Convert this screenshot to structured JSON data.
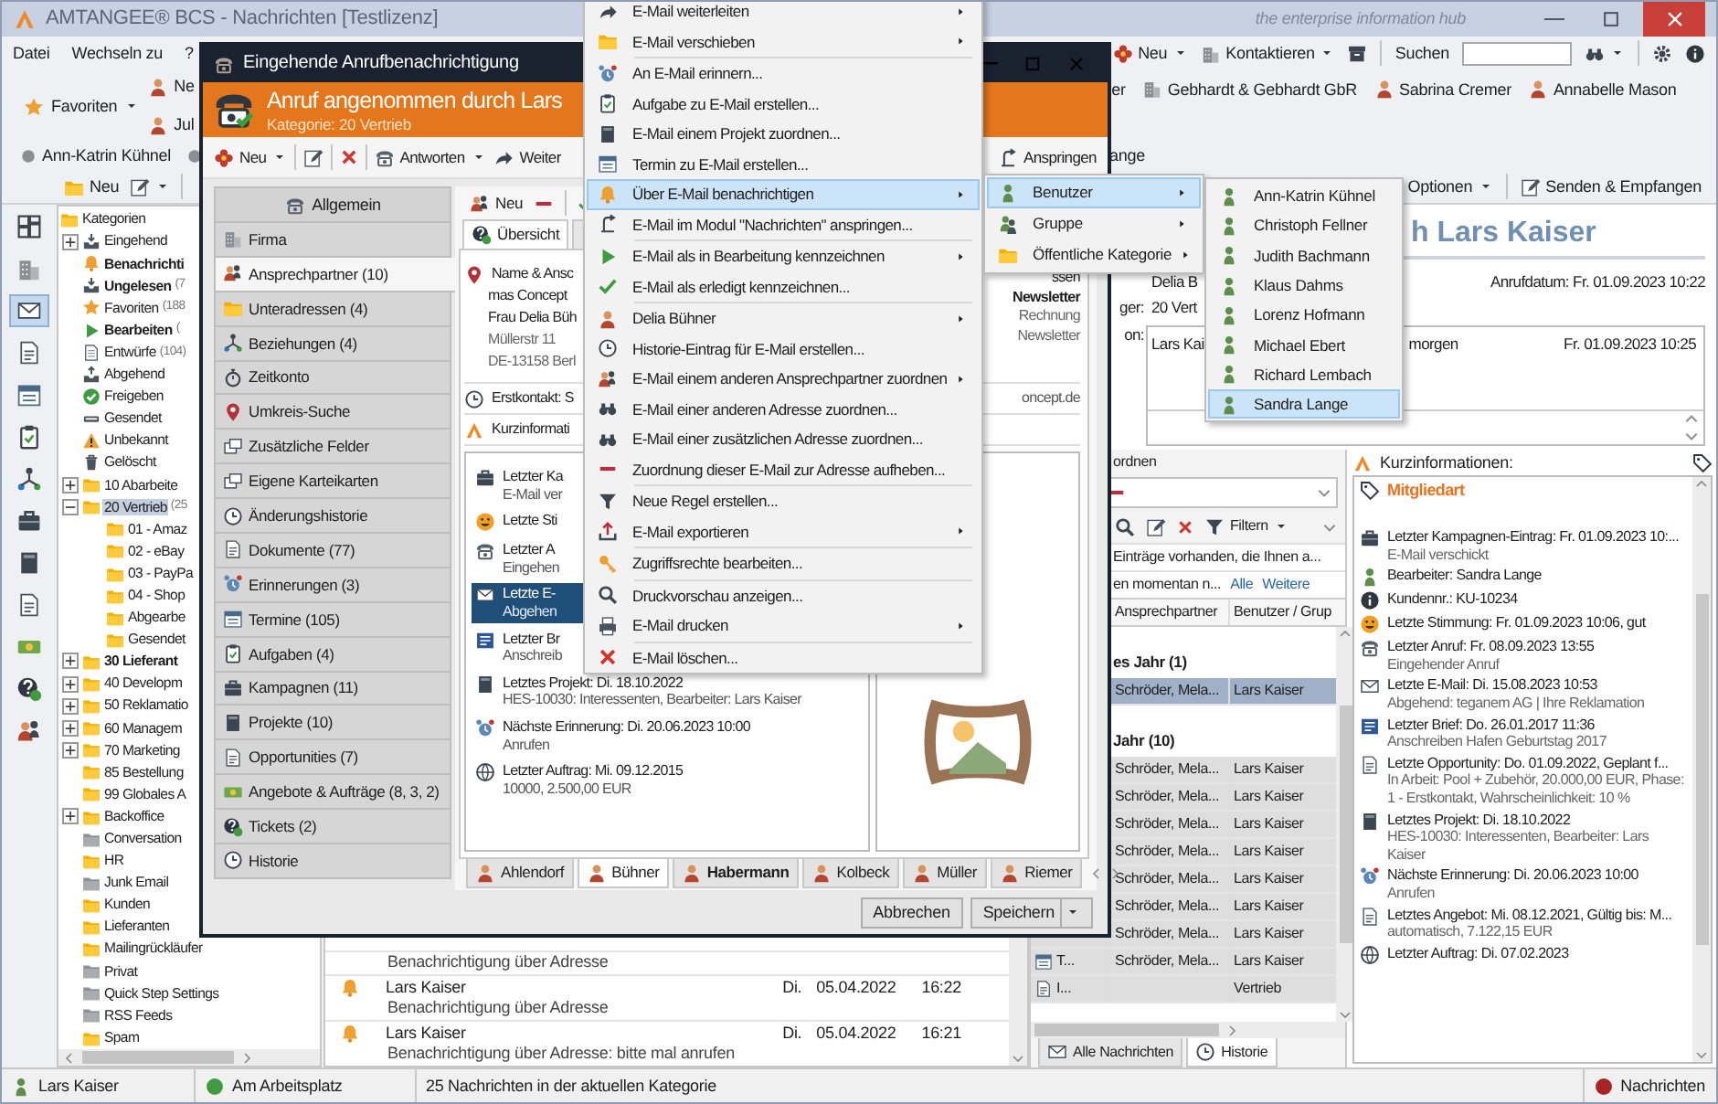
{
  "window": {
    "title": "AMTANGEE® BCS - Nachrichten [Testlizenz]",
    "tagline": "the enterprise information hub"
  },
  "menu_bar": [
    "Datei",
    "Wechseln zu",
    "?"
  ],
  "main_toolbar": {
    "new_label": "Neu",
    "contact_label": "Kontaktieren",
    "search_label": "Suchen"
  },
  "favorites": {
    "label": "Favoriten",
    "left": [
      {
        "label": "Ne",
        "kind": "person"
      },
      {
        "label": "Jul",
        "kind": "person"
      }
    ],
    "right": [
      {
        "label": "er",
        "kind": "none"
      },
      {
        "label": "Gebhardt & Gebhardt GbR",
        "kind": "company"
      },
      {
        "label": "Sabrina Cremer",
        "kind": "person"
      },
      {
        "label": "Annabelle Mason",
        "kind": "person"
      }
    ]
  },
  "users_bar": {
    "items": [
      "Ann-Katrin Kühnel"
    ],
    "trailing": "ange"
  },
  "module_toolbar": {
    "new_label": "Neu",
    "options_label": "Optionen",
    "send_label": "Senden & Empfangen"
  },
  "nav_icons": [
    {
      "kind": "dashboard",
      "selected": false
    },
    {
      "kind": "companies",
      "selected": false
    },
    {
      "kind": "messages",
      "selected": true
    },
    {
      "kind": "documents",
      "selected": false
    },
    {
      "kind": "calendar",
      "selected": false
    },
    {
      "kind": "tasks",
      "selected": false
    },
    {
      "kind": "relations",
      "selected": false
    },
    {
      "kind": "campaigns",
      "selected": false
    },
    {
      "kind": "projects",
      "selected": false
    },
    {
      "kind": "opportunities",
      "selected": false
    },
    {
      "kind": "offers",
      "selected": false
    },
    {
      "kind": "tickets",
      "selected": false
    },
    {
      "kind": "users",
      "selected": false
    }
  ],
  "categories": {
    "root": "Kategorien",
    "items": [
      {
        "label": "Eingehend",
        "kind": "inbox",
        "expanded": false,
        "bold": false,
        "selected": false
      },
      {
        "label": "Benachrichti",
        "kind": "notification",
        "bold": true,
        "selected": false
      },
      {
        "label": "Ungelesen",
        "count": "(7",
        "kind": "inbox",
        "bold": true,
        "selected": false
      },
      {
        "label": "Favoriten",
        "count": "(188",
        "kind": "favorites",
        "bold": false,
        "selected": false
      },
      {
        "label": "Bearbeiten",
        "count": "(",
        "kind": "processing",
        "bold": true,
        "selected": false
      },
      {
        "label": "Entwürfe",
        "count": "(104)",
        "kind": "drafts",
        "bold": false,
        "selected": false
      },
      {
        "label": "Abgehend",
        "kind": "outbox",
        "bold": false,
        "selected": false
      },
      {
        "label": "Freigeben",
        "kind": "approval",
        "bold": false,
        "selected": false
      },
      {
        "label": "Gesendet",
        "kind": "sent",
        "bold": false,
        "selected": false
      },
      {
        "label": "Unbekannt",
        "kind": "unknown",
        "bold": false,
        "selected": false
      },
      {
        "label": "Gelöscht",
        "kind": "trash",
        "bold": false,
        "selected": false
      },
      {
        "label": "10 Abarbeite",
        "kind": "folder",
        "expanded": false,
        "bold": false,
        "selected": false
      },
      {
        "label": "20 Vertrieb",
        "count": "(25",
        "kind": "folder",
        "expanded": true,
        "bold": false,
        "selected": true,
        "children": [
          {
            "label": "01 - Amaz",
            "kind": "folder",
            "bold": false,
            "selected": false
          },
          {
            "label": "02 - eBay",
            "kind": "folder",
            "bold": false,
            "selected": false
          },
          {
            "label": "03 - PayPa",
            "kind": "folder",
            "bold": false,
            "selected": false
          },
          {
            "label": "04 - Shop",
            "kind": "folder",
            "bold": false,
            "selected": false
          },
          {
            "label": "Abgearbe",
            "kind": "folder",
            "bold": false,
            "selected": false
          },
          {
            "label": "Gesendet",
            "kind": "folder",
            "bold": false,
            "selected": false
          }
        ]
      },
      {
        "label": "30 Lieferant",
        "kind": "folder",
        "expanded": false,
        "bold": true,
        "selected": false
      },
      {
        "label": "40 Developm",
        "kind": "folder",
        "expanded": false,
        "bold": false,
        "selected": false
      },
      {
        "label": "50 Reklamatio",
        "kind": "folder",
        "expanded": false,
        "bold": false,
        "selected": false
      },
      {
        "label": "60 Managem",
        "kind": "folder",
        "expanded": false,
        "bold": false,
        "selected": false
      },
      {
        "label": "70 Marketing",
        "kind": "folder",
        "expanded": false,
        "bold": false,
        "selected": false
      },
      {
        "label": "85 Bestellung",
        "kind": "folder",
        "bold": false,
        "selected": false
      },
      {
        "label": "99 Globales A",
        "kind": "folder",
        "bold": false,
        "selected": false
      },
      {
        "label": "Backoffice",
        "kind": "folder",
        "expanded": false,
        "bold": false,
        "selected": false
      },
      {
        "label": "Conversation",
        "kind": "system",
        "bold": false,
        "selected": false
      },
      {
        "label": "HR",
        "kind": "folder",
        "bold": false,
        "selected": false
      },
      {
        "label": "Junk Email",
        "kind": "system",
        "bold": false,
        "selected": false
      },
      {
        "label": "Kunden",
        "kind": "folder",
        "bold": false,
        "selected": false
      },
      {
        "label": "Lieferanten",
        "kind": "folder",
        "bold": false,
        "selected": false
      },
      {
        "label": "Mailingrückläufer",
        "kind": "folder",
        "bold": false,
        "selected": false
      },
      {
        "label": "Privat",
        "kind": "system",
        "bold": false,
        "selected": false
      },
      {
        "label": "Quick Step Settings",
        "kind": "system",
        "bold": false,
        "selected": false
      },
      {
        "label": "RSS Feeds",
        "kind": "system",
        "bold": false,
        "selected": false
      },
      {
        "label": "Spam",
        "kind": "folder",
        "bold": false,
        "selected": false
      }
    ]
  },
  "messages": [
    {
      "subject": "Benachrichtigung über Adresse"
    },
    {
      "sender": "Lars Kaiser",
      "day": "Di.",
      "date": "05.04.2022",
      "time": "16:22",
      "subject": "Benachrichtigung über Adresse"
    },
    {
      "sender": "Lars Kaiser",
      "day": "Di.",
      "date": "05.04.2022",
      "time": "16:21",
      "subject": "Benachrichtigung über Adresse: bitte mal anrufen"
    }
  ],
  "reading_pane": {
    "title": "h Lars Kaiser",
    "call_date": "Anrufdatum: Fr. 01.09.2023 10:22",
    "fields": [
      {
        "value": "Delia B"
      },
      {
        "label": "ger:",
        "value": "20 Vert"
      }
    ],
    "notes_label": "on:",
    "note": {
      "author": "Lars Kai",
      "text": "morgen",
      "date": "Fr. 01.09.2023 10:25"
    }
  },
  "linked_panel": {
    "title": "ordnen",
    "filter_label": "Filtern",
    "notice": "Einträge vorhanden, die Ihnen a...",
    "notice2": "en momentan n...",
    "links": [
      "Alle",
      "Weitere"
    ],
    "columns": [
      "Ansprechpartner",
      "Benutzer / Grup"
    ],
    "groups": [
      {
        "label": "es Jahr (1)",
        "rows": [
          {
            "contact": "Schröder, Mela...",
            "user": "Lars Kaiser",
            "selected": true
          }
        ]
      },
      {
        "label": "Jahr (10)",
        "rows": [
          {
            "contact": "Schröder, Mela...",
            "user": "Lars Kaiser",
            "selected": false
          },
          {
            "contact": "Schröder, Mela...",
            "user": "Lars Kaiser",
            "selected": false
          },
          {
            "contact": "Schröder, Mela...",
            "user": "Lars Kaiser",
            "selected": false
          },
          {
            "contact": "Schröder, Mela...",
            "user": "Lars Kaiser",
            "selected": false
          },
          {
            "contact": "Schröder, Mela...",
            "user": "Lars Kaiser",
            "selected": false
          },
          {
            "contact": "Schröder, Mela...",
            "user": "Lars Kaiser",
            "selected": false
          },
          {
            "contact": "Schröder, Mela...",
            "user": "Lars Kaiser",
            "selected": false
          },
          {
            "lead": "T...",
            "kind": "appointment",
            "contact": "Schröder, Mela...",
            "user": "Lars Kaiser",
            "selected": false
          },
          {
            "lead": "I...",
            "kind": "opportunity",
            "user": "Vertrieb",
            "selected": false
          }
        ]
      }
    ],
    "tabs": [
      {
        "label": "Alle Nachrichten",
        "kind": "messages",
        "selected": false
      },
      {
        "label": "Historie",
        "kind": "history",
        "selected": true
      }
    ]
  },
  "short_info": {
    "title": "Kurzinformationen:",
    "member_label": "Mitgliedart",
    "items": [
      {
        "kind": "campaign",
        "title": "Letzter Kampagnen-Eintrag: Fr. 01.09.2023 10:...",
        "detail": "E-Mail verschickt"
      },
      {
        "kind": "user",
        "title": "Bearbeiter: Sandra Lange"
      },
      {
        "kind": "info",
        "title": "Kundennr.: KU-10234"
      },
      {
        "kind": "mood",
        "title": "Letzte Stimmung: Fr. 01.09.2023 10:06, gut"
      },
      {
        "kind": "phone",
        "title": "Letzter Anruf: Fr. 08.09.2023 13:55",
        "detail": "Eingehender Anruf"
      },
      {
        "kind": "mail",
        "title": "Letzte E-Mail: Di. 15.08.2023 10:53",
        "detail": "Abgehend: teganem AG | Ihre Reklamation"
      },
      {
        "kind": "letter",
        "title": "Letzter Brief: Do. 26.01.2017 11:36",
        "detail": "Anschreiben Hafen Geburtstag 2017"
      },
      {
        "kind": "opportunity",
        "title": "Letzte Opportunity: Do. 01.09.2022, Geplant f...",
        "detail": "In Arbeit: Pool + Zubehör, 20.000,00 EUR, Phase: 1 - Erstkontakt, Wahrscheinlichkeit: 10 %"
      },
      {
        "kind": "project",
        "title": "Letztes Projekt: Di. 18.10.2022",
        "detail": "HES-10030: Interessenten, Bearbeiter: Lars Kaiser"
      },
      {
        "kind": "reminder",
        "title": "Nächste Erinnerung: Di. 20.06.2023 10:00",
        "detail": "Anrufen"
      },
      {
        "kind": "offer",
        "title": "Letztes Angebot: Mi. 08.12.2021, Gültig bis: M...",
        "detail": "automatisch, 7.122,15 EUR"
      },
      {
        "kind": "order",
        "title": "Letzter Auftrag: Di. 07.02.2023"
      }
    ]
  },
  "status_bar": {
    "user": "Lars Kaiser",
    "presence": "Am Arbeitsplatz",
    "count": "25 Nachrichten in der aktuellen Kategorie",
    "module": "Nachrichten"
  },
  "dialog": {
    "title": "Eingehende Anrufbenachrichtigung",
    "heading": "Anruf angenommen durch Lars",
    "category": "Kategorie: 20 Vertrieb",
    "toolbar": {
      "new_label": "Neu",
      "reply_label": "Antworten",
      "forward_label": "Weiter",
      "jump_label": "Anspringen"
    },
    "side_header": "Allgemein",
    "side_tabs": [
      {
        "label": "Firma",
        "kind": "company",
        "selected": false
      },
      {
        "label": "Ansprechpartner (10)",
        "kind": "contacts",
        "selected": true
      },
      {
        "label": "Unteradressen (4)",
        "kind": "subaddresses",
        "selected": false
      },
      {
        "label": "Beziehungen (4)",
        "kind": "relations",
        "selected": false
      },
      {
        "label": "Zeitkonto",
        "kind": "timesheet",
        "selected": false
      },
      {
        "label": "Umkreis-Suche",
        "kind": "radius",
        "selected": false
      },
      {
        "label": "Zusätzliche Felder",
        "kind": "fields",
        "selected": false
      },
      {
        "label": "Eigene Karteikarten",
        "kind": "fields",
        "selected": false
      },
      {
        "label": "Änderungshistorie",
        "kind": "history",
        "selected": false
      },
      {
        "label": "Dokumente (77)",
        "kind": "documents",
        "selected": false
      },
      {
        "label": "Erinnerungen (3)",
        "kind": "reminder",
        "selected": false
      },
      {
        "label": "Termine (105)",
        "kind": "calendar",
        "selected": false
      },
      {
        "label": "Aufgaben (4)",
        "kind": "tasks",
        "selected": false
      },
      {
        "label": "Kampagnen (11)",
        "kind": "campaign",
        "selected": false
      },
      {
        "label": "Projekte (10)",
        "kind": "project",
        "selected": false
      },
      {
        "label": "Opportunities (7)",
        "kind": "opportunity",
        "selected": false
      },
      {
        "label": "Angebote & Aufträge (8, 3, 2)",
        "kind": "offers",
        "selected": false
      },
      {
        "label": "Tickets (2)",
        "kind": "tickets",
        "selected": false
      },
      {
        "label": "Historie",
        "kind": "history",
        "selected": false
      }
    ],
    "content": {
      "new_label": "Neu",
      "tab": "Übersicht",
      "address_header": "Name & Ansc",
      "address": [
        "mas Concept",
        "Frau Delia Büh",
        "Müllerstr 11",
        "DE-13158 Berl"
      ],
      "right_snippets": {
        "top": "ssen",
        "heading": "Newsletter",
        "rows": [
          "Rechnung",
          "Newsletter"
        ],
        "web": "oncept.de"
      },
      "first_contact": "Erstkontakt: S",
      "info_header": "Kurzinformati",
      "info": [
        {
          "kind": "campaign",
          "title": "Letzter Ka",
          "detail": "E-Mail ver",
          "selected": false
        },
        {
          "kind": "mood",
          "title": "Letzte Sti",
          "selected": false
        },
        {
          "kind": "phone",
          "title": "Letzter A",
          "detail": "Eingehen",
          "selected": false
        },
        {
          "kind": "mail",
          "title": "Letzte E-",
          "detail": "Abgehen",
          "selected": true
        },
        {
          "kind": "letter",
          "title": "Letzter Br",
          "detail": "Anschreib",
          "selected": false
        },
        {
          "kind": "project",
          "title": "Letztes Projekt: Di. 18.10.2022",
          "detail": "HES-10030: Interessenten, Bearbeiter: Lars Kaiser",
          "selected": false
        },
        {
          "kind": "reminder",
          "title": "Nächste Erinnerung: Di. 20.06.2023 10:00",
          "detail": "Anrufen",
          "selected": false
        },
        {
          "kind": "order",
          "title": "Letzter Auftrag: Mi. 09.12.2015",
          "detail": "10000, 2.500,00 EUR",
          "selected": false
        }
      ],
      "contact_tabs": [
        {
          "label": "Ahlendorf",
          "bold": false,
          "selected": false
        },
        {
          "label": "Bühner",
          "bold": false,
          "selected": true
        },
        {
          "label": "Habermann",
          "bold": true,
          "selected": false
        },
        {
          "label": "Kolbeck",
          "bold": false,
          "selected": false
        },
        {
          "label": "Müller",
          "bold": false,
          "selected": false
        },
        {
          "label": "Riemer",
          "bold": false,
          "selected": false
        }
      ]
    },
    "buttons": {
      "cancel": "Abbrechen",
      "save": "Speichern"
    }
  },
  "context_menu": {
    "groups": [
      [
        {
          "kind": "forward",
          "label": "E-Mail weiterleiten",
          "submenu": true,
          "selected": false
        },
        {
          "kind": "move",
          "label": "E-Mail verschieben",
          "submenu": true,
          "selected": false
        }
      ],
      [
        {
          "kind": "reminder",
          "label": "An E-Mail erinnern...",
          "submenu": false,
          "selected": false
        },
        {
          "kind": "tasks",
          "label": "Aufgabe zu E-Mail erstellen...",
          "submenu": false,
          "selected": false
        },
        {
          "kind": "project",
          "label": "E-Mail einem Projekt zuordnen...",
          "submenu": false,
          "selected": false
        },
        {
          "kind": "calendar",
          "label": "Termin zu E-Mail erstellen...",
          "submenu": false,
          "selected": false
        },
        {
          "kind": "notify",
          "label": "Über E-Mail benachrichtigen",
          "submenu": true,
          "selected": true
        },
        {
          "kind": "jump",
          "label": "E-Mail im Modul \"Nachrichten\" anspringen...",
          "submenu": false,
          "selected": false
        }
      ],
      [
        {
          "kind": "progress",
          "label": "E-Mail als in Bearbeitung kennzeichnen",
          "submenu": true,
          "selected": false
        },
        {
          "kind": "done",
          "label": "E-Mail als erledigt kennzeichnen...",
          "submenu": false,
          "selected": false
        }
      ],
      [
        {
          "kind": "contact",
          "label": "Delia Bühner",
          "submenu": true,
          "selected": false
        },
        {
          "kind": "history",
          "label": "Historie-Eintrag für E-Mail erstellen...",
          "submenu": false,
          "selected": false
        },
        {
          "kind": "contacts",
          "label": "E-Mail einem anderen Ansprechpartner zuordnen",
          "submenu": true,
          "selected": false
        },
        {
          "kind": "address",
          "label": "E-Mail einer anderen Adresse zuordnen...",
          "submenu": false,
          "selected": false
        },
        {
          "kind": "address",
          "label": "E-Mail einer zusätzlichen Adresse zuordnen...",
          "submenu": false,
          "selected": false
        },
        {
          "kind": "unassign",
          "label": "Zuordnung dieser E-Mail zur Adresse aufheben...",
          "submenu": false,
          "selected": false
        }
      ],
      [
        {
          "kind": "rule",
          "label": "Neue Regel erstellen...",
          "submenu": false,
          "selected": false
        },
        {
          "kind": "export",
          "label": "E-Mail exportieren",
          "submenu": true,
          "selected": false
        }
      ],
      [
        {
          "kind": "rights",
          "label": "Zugriffsrechte bearbeiten...",
          "submenu": false,
          "selected": false
        }
      ],
      [
        {
          "kind": "preview",
          "label": "Druckvorschau anzeigen...",
          "submenu": false,
          "selected": false
        },
        {
          "kind": "print",
          "label": "E-Mail drucken",
          "submenu": true,
          "selected": false
        }
      ],
      [
        {
          "kind": "delete",
          "label": "E-Mail löschen...",
          "submenu": false,
          "selected": false
        }
      ]
    ]
  },
  "submenu": {
    "items": [
      {
        "kind": "user",
        "label": "Benutzer",
        "submenu": true,
        "selected": true
      },
      {
        "kind": "group",
        "label": "Gruppe",
        "submenu": true,
        "selected": false
      },
      {
        "kind": "category",
        "label": "Öffentliche Kategorie",
        "submenu": true,
        "selected": false
      }
    ]
  },
  "user_menu": {
    "items": [
      {
        "label": "Ann-Katrin Kühnel",
        "selected": false
      },
      {
        "label": "Christoph Fellner",
        "selected": false
      },
      {
        "label": "Judith Bachmann",
        "selected": false
      },
      {
        "label": "Klaus Dahms",
        "selected": false
      },
      {
        "label": "Lorenz Hofmann",
        "selected": false
      },
      {
        "label": "Michael Ebert",
        "selected": false
      },
      {
        "label": "Richard Lembach",
        "selected": false
      },
      {
        "label": "Sandra Lange",
        "selected": true
      }
    ]
  }
}
